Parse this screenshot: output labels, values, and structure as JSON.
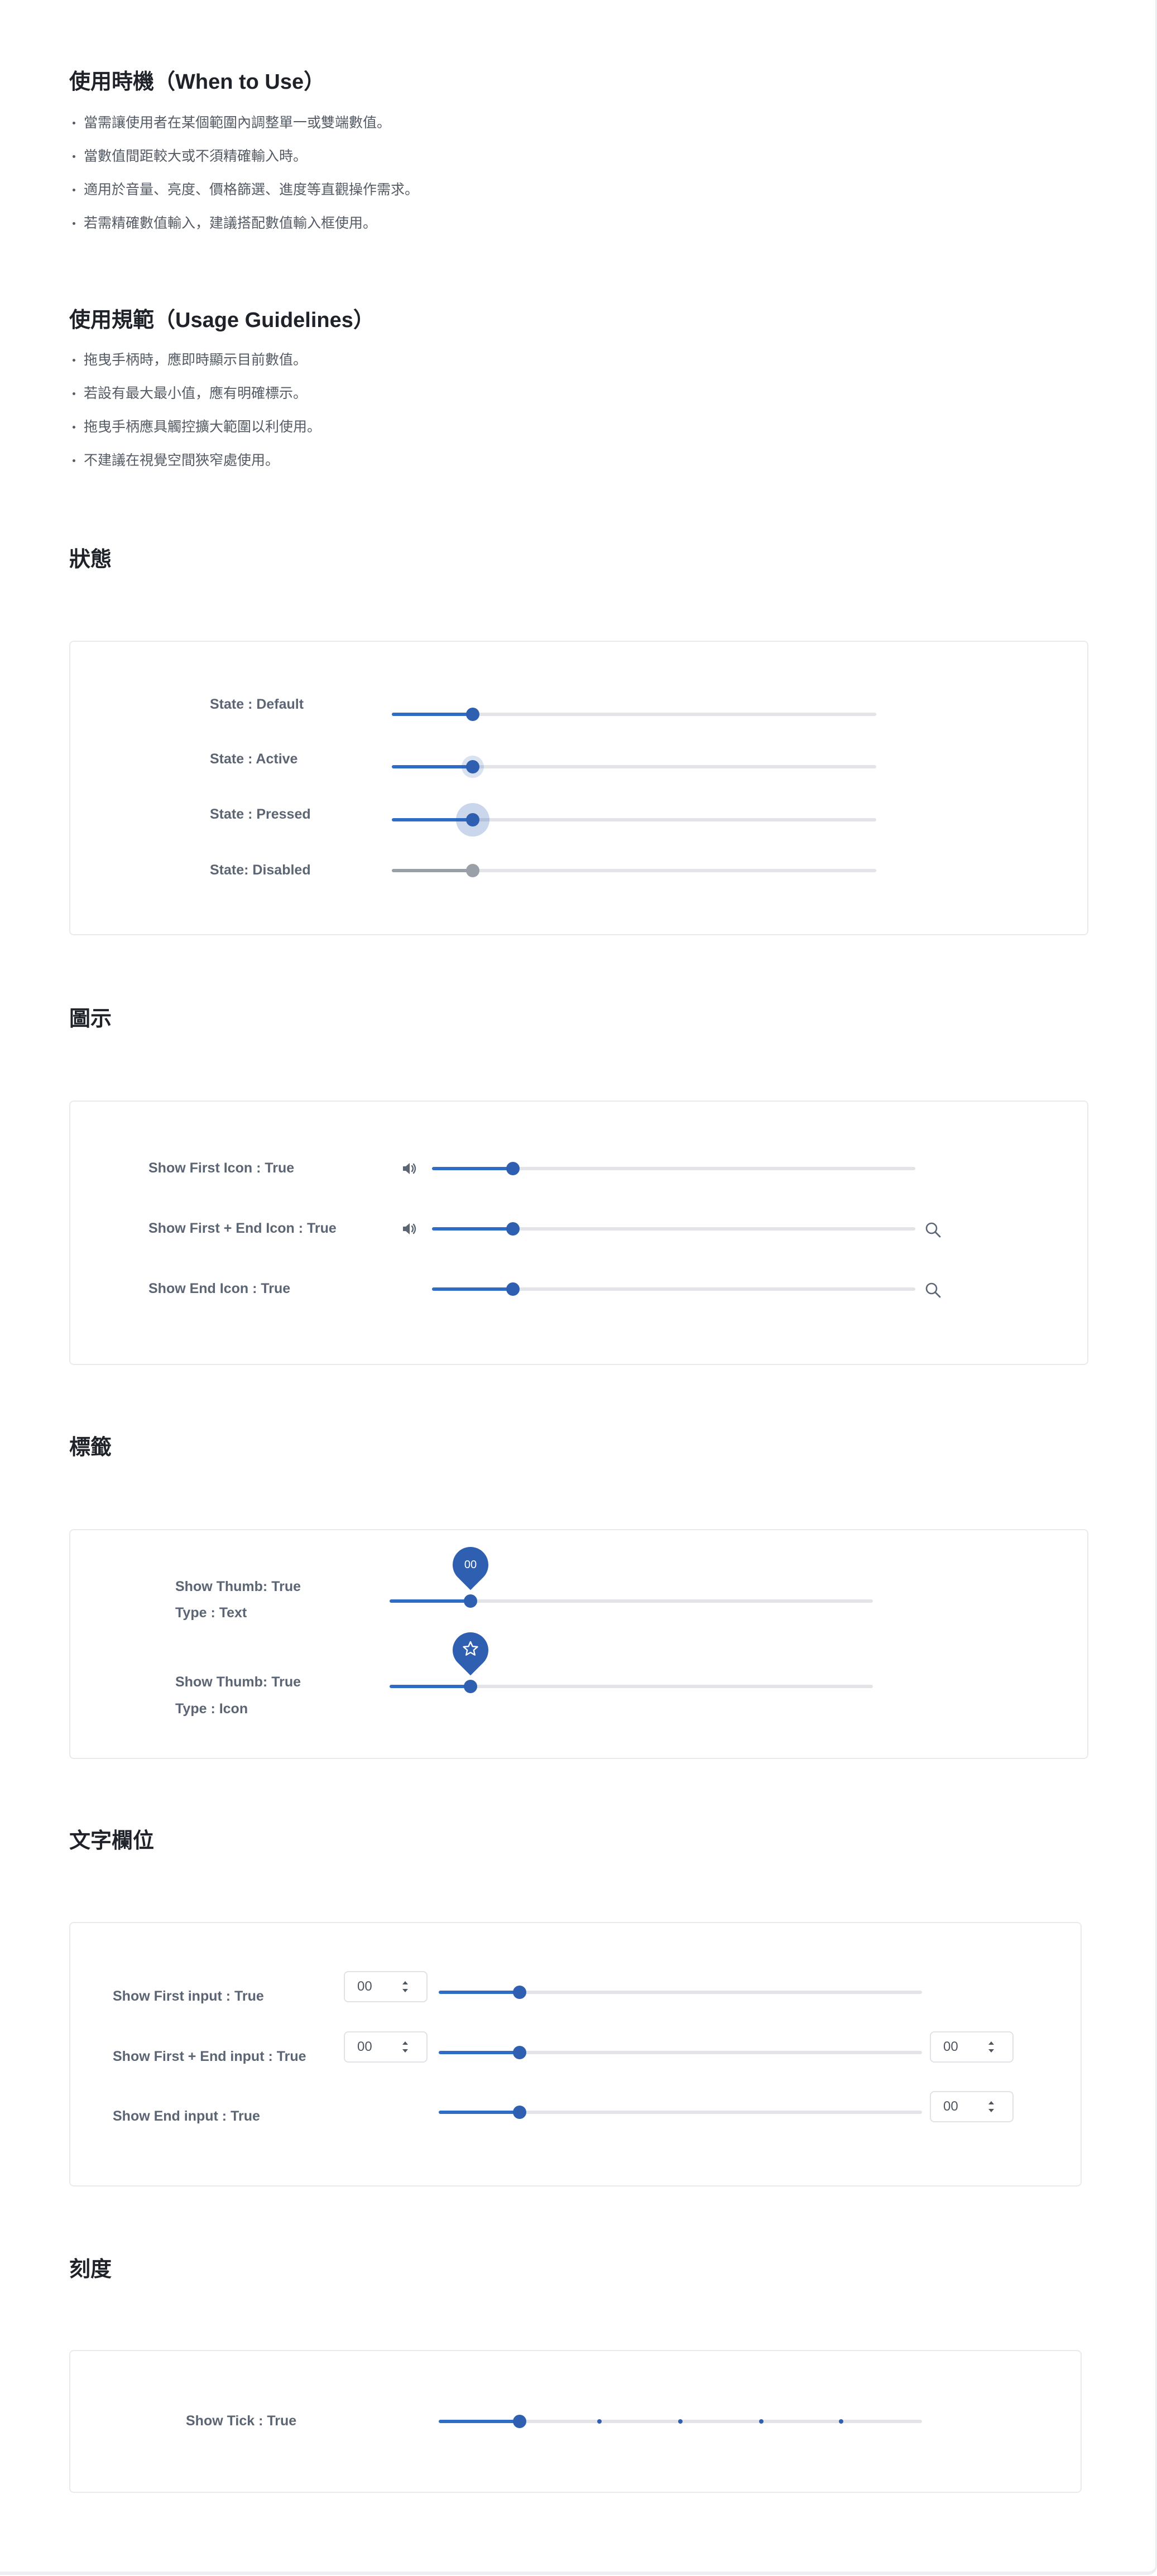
{
  "sections": {
    "when": {
      "title": "使用時機（When to Use）",
      "items": [
        "當需讓使用者在某個範圍內調整單一或雙端數值。",
        "當數值間距較大或不須精確輸入時。",
        "適用於音量、亮度、價格篩選、進度等直觀操作需求。",
        "若需精確數值輸入，建議搭配數值輸入框使用。"
      ]
    },
    "usage": {
      "title": "使用規範（Usage Guidelines）",
      "items": [
        "拖曳手柄時，應即時顯示目前數值。",
        "若設有最大最小值，應有明確標示。",
        "拖曳手柄應具觸控擴大範圍以利使用。",
        "不建議在視覺空間狹窄處使用。"
      ]
    },
    "states": {
      "title": "狀態",
      "rows": [
        {
          "label": "State : Default",
          "state": "default",
          "value": 0.167
        },
        {
          "label": "State : Active",
          "state": "active",
          "value": 0.167
        },
        {
          "label": "State : Pressed",
          "state": "pressed",
          "value": 0.167
        },
        {
          "label": "State: Disabled",
          "state": "disabled",
          "value": 0.167
        }
      ]
    },
    "icons": {
      "title": "圖示",
      "rows": [
        {
          "label": "Show First Icon : True",
          "first_icon": "volume-icon",
          "end_icon": "",
          "value": 0.167
        },
        {
          "label": "Show First + End Icon : True",
          "first_icon": "volume-icon",
          "end_icon": "search-icon",
          "value": 0.167
        },
        {
          "label": "Show End Icon : True",
          "first_icon": "",
          "end_icon": "search-icon",
          "value": 0.167
        }
      ]
    },
    "tags": {
      "title": "標籤",
      "rows": [
        {
          "label_line1": "Show Thumb: True",
          "label_line2": "Type : Text",
          "pin_type": "text",
          "pin_text": "00",
          "value": 0.167
        },
        {
          "label_line1": "Show Thumb: True",
          "label_line2": "Type : Icon",
          "pin_type": "icon",
          "pin_icon": "star-icon",
          "value": 0.167
        }
      ]
    },
    "inputs": {
      "title": "文字欄位",
      "rows": [
        {
          "label": "Show First input : True",
          "first_value": "00",
          "end_value": "",
          "value": 0.167
        },
        {
          "label": "Show First + End input : True",
          "first_value": "00",
          "end_value": "00",
          "value": 0.167
        },
        {
          "label": "Show End input : True",
          "first_value": "",
          "end_value": "00",
          "value": 0.167
        }
      ]
    },
    "ticks": {
      "title": "刻度",
      "rows": [
        {
          "label": "Show Tick : True",
          "value": 0.167,
          "ticks": [
            0.333,
            0.5,
            0.667,
            0.833
          ]
        }
      ]
    }
  },
  "colors": {
    "accent": "#2f6cc6",
    "thumb": "#2f5fb0",
    "track": "#e2e4e8",
    "disabled": "#9aa0a8"
  }
}
